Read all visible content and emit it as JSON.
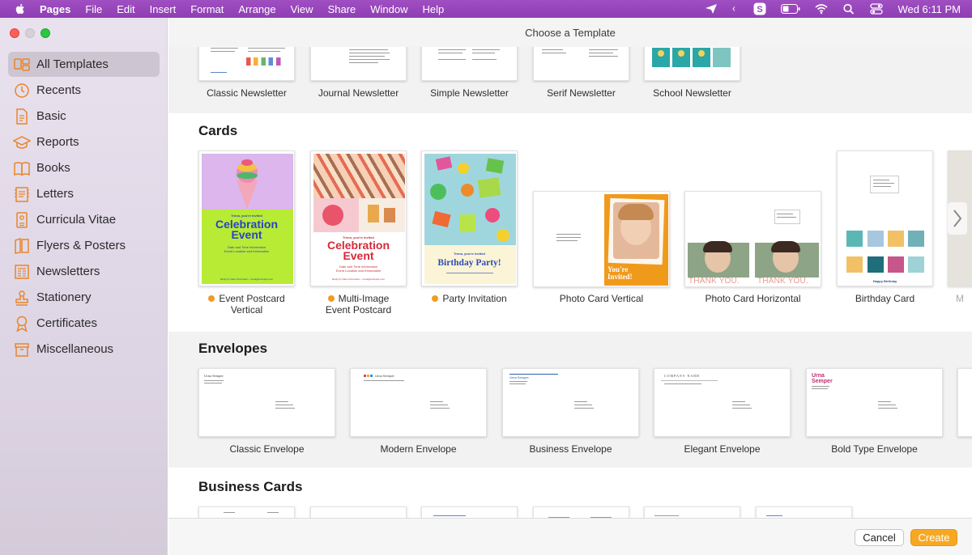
{
  "menubar": {
    "app": "Pages",
    "items": [
      "File",
      "Edit",
      "Insert",
      "Format",
      "Arrange",
      "View",
      "Share",
      "Window",
      "Help"
    ],
    "clock": "Wed  6:11 PM",
    "status_icons": [
      "send-icon",
      "chevron-left-icon",
      "skype-icon",
      "battery-icon",
      "wifi-icon",
      "search-icon",
      "control-center-icon"
    ]
  },
  "window": {
    "title": "Choose a Template"
  },
  "sidebar": {
    "items": [
      {
        "label": "All Templates",
        "icon": "all-templates-icon",
        "active": true
      },
      {
        "label": "Recents",
        "icon": "clock-icon"
      },
      {
        "label": "Basic",
        "icon": "document-icon"
      },
      {
        "label": "Reports",
        "icon": "graduation-cap-icon"
      },
      {
        "label": "Books",
        "icon": "book-icon"
      },
      {
        "label": "Letters",
        "icon": "letter-icon"
      },
      {
        "label": "Curricula Vitae",
        "icon": "person-document-icon"
      },
      {
        "label": "Flyers & Posters",
        "icon": "flyer-icon"
      },
      {
        "label": "Newsletters",
        "icon": "newsletter-icon"
      },
      {
        "label": "Stationery",
        "icon": "stamp-icon"
      },
      {
        "label": "Certificates",
        "icon": "ribbon-icon"
      },
      {
        "label": "Miscellaneous",
        "icon": "box-icon"
      }
    ]
  },
  "newsletters": {
    "items": [
      "Classic Newsletter",
      "Journal Newsletter",
      "Simple Newsletter",
      "Serif Newsletter",
      "School Newsletter"
    ]
  },
  "cards": {
    "title": "Cards",
    "items": [
      {
        "label_line1": "Event Postcard",
        "label_line2": "Vertical",
        "new": true
      },
      {
        "label_line1": "Multi-Image",
        "label_line2": "Event Postcard",
        "new": true
      },
      {
        "label_line1": "Party Invitation",
        "new": true
      },
      {
        "label_line1": "Photo Card Vertical"
      },
      {
        "label_line1": "Photo Card Horizontal"
      },
      {
        "label_line1": "Birthday Card"
      },
      {
        "label_line1": "M"
      }
    ],
    "art": {
      "invite_line": "Trena, you're invited",
      "headline1": "Celebration",
      "headline2": "Event",
      "details1": "Date and Time Information",
      "details2": "Event Location and Information",
      "rsvp": "Reply by Date Information · trena@example.com",
      "party_invite": "Trena, you're invited",
      "party_headline": "Birthday Party!",
      "youre": "You're",
      "invited": "Invited!",
      "thank_you": "THANK YOU.",
      "happy_birthday": "Happy Birthday"
    }
  },
  "envelopes": {
    "title": "Envelopes",
    "items": [
      "Classic Envelope",
      "Modern Envelope",
      "Business Envelope",
      "Elegant Envelope",
      "Bold Type Envelope"
    ],
    "sender_name": "Urna Semper",
    "sender_first": "Urna",
    "sender_last": "Semper",
    "company": "COMPANY NAME"
  },
  "business_cards": {
    "title": "Business Cards"
  },
  "buttons": {
    "cancel": "Cancel",
    "create": "Create"
  },
  "colors": {
    "menubar": "#9a48bd",
    "accent": "#f7a823",
    "new_dot": "#f29b1f"
  }
}
